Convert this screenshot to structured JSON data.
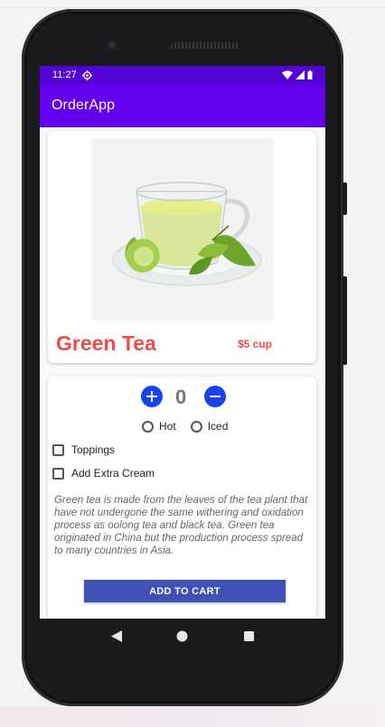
{
  "status_bar": {
    "time": "11:27"
  },
  "app_bar": {
    "title": "OrderApp"
  },
  "product": {
    "name": "Green Tea",
    "price": "$5 cup"
  },
  "quantity": {
    "value": "0"
  },
  "temperature": {
    "options": [
      "Hot",
      "Iced"
    ]
  },
  "extras": [
    {
      "label": "Toppings",
      "checked": false
    },
    {
      "label": "Add Extra Cream",
      "checked": false
    }
  ],
  "description": "Green tea is made from the leaves of the tea plant that have not undergone the same withering and oxidation process as oolong tea and black tea. Green tea originated in China but the production process spread to many countries in Asia.",
  "actions": {
    "add_to_cart": "ADD TO CART"
  },
  "colors": {
    "status_bar": "#5104d1",
    "app_bar": "#6200ee",
    "accent_red": "#f04a4a",
    "qty_button": "#1a43f0",
    "cart_button": "#3f51b5"
  },
  "icons": {
    "status_settings": "gear-icon",
    "nav_back": "back-triangle-icon",
    "nav_home": "home-circle-icon",
    "nav_recents": "recents-square-icon"
  }
}
